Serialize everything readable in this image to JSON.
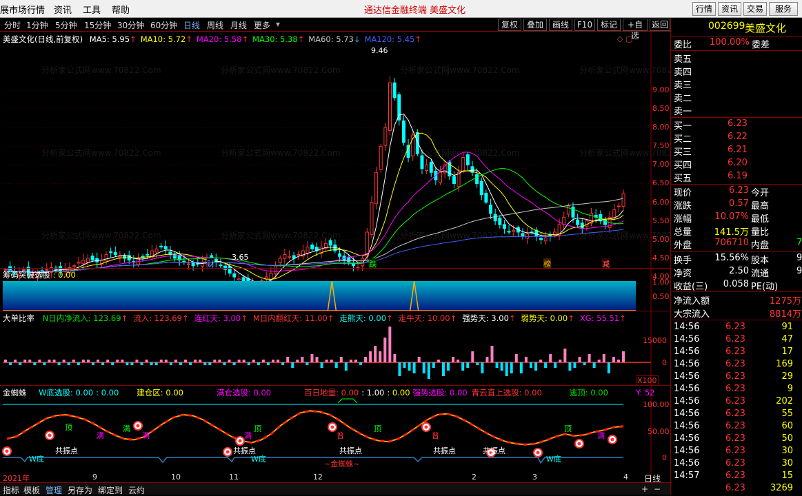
{
  "menubar": {
    "app_title": "展市场行情",
    "menus": [
      "资讯",
      "工具",
      "帮助"
    ],
    "center_title": "通达信金融终端   美盛文化",
    "right_buttons": [
      "行情",
      "资讯",
      "交易",
      "服务"
    ]
  },
  "periods": [
    "分时",
    "1分钟",
    "5分钟",
    "15分钟",
    "30分钟",
    "60分钟",
    "日线",
    "周线",
    "月线",
    "更多"
  ],
  "active_period": "日线",
  "toolbar": [
    "复权",
    "叠加",
    "画线",
    "F10",
    "标记",
    "+自选",
    "返回"
  ],
  "main": {
    "title": "美盛文化(日线,前复权)",
    "ma": [
      {
        "label": "MA5: 5.95",
        "color": "#ffffff"
      },
      {
        "label": "MA10: 5.72",
        "color": "#ffff00"
      },
      {
        "label": "MA20: 5.58",
        "color": "#ff00ff"
      },
      {
        "label": "MA30: 5.38",
        "color": "#00ff00"
      },
      {
        "label": "MA60: 5.73",
        "color": "#c8c8c8"
      },
      {
        "label": "MA120: 5.45",
        "color": "#4060ff"
      }
    ],
    "high_label": "9.46",
    "low_label": "3.65",
    "price_ticks": [
      "9.00",
      "8.50",
      "8.00",
      "7.50",
      "7.00",
      "6.50",
      "6.00",
      "5.50",
      "5.00",
      "4.50",
      "4.00"
    ],
    "event_marks": [
      "财",
      "跌",
      "榜",
      "减"
    ],
    "watermark": "分析家公式网www.70822.Com"
  },
  "chart_data": {
    "type": "candlestick",
    "price_axis": [
      3.65,
      9.46
    ],
    "close": [
      4.2,
      4.15,
      4.1,
      4.15,
      4.2,
      4.1,
      4.05,
      4.1,
      4.15,
      4.2,
      4.25,
      4.2,
      4.15,
      4.2,
      4.25,
      4.3,
      4.4,
      4.45,
      4.5,
      4.45,
      4.4,
      4.45,
      4.6,
      4.65,
      4.6,
      4.55,
      4.5,
      4.45,
      4.4,
      4.5,
      4.55,
      4.6,
      4.7,
      4.75,
      4.8,
      4.75,
      4.6,
      4.5,
      4.45,
      4.4,
      4.35,
      4.3,
      4.35,
      4.4,
      4.5,
      4.45,
      4.4,
      4.3,
      4.2,
      4.1,
      4.0,
      3.95,
      3.9,
      3.85,
      3.8,
      3.75,
      3.9,
      4.0,
      4.1,
      4.3,
      4.5,
      4.6,
      4.55,
      4.5,
      4.6,
      4.7,
      4.8,
      4.75,
      4.7,
      4.8,
      4.9,
      4.85,
      4.7,
      4.55,
      4.45,
      4.4,
      4.3,
      4.25,
      4.5,
      5.2,
      6.0,
      6.8,
      7.5,
      8.0,
      9.2,
      8.8,
      8.2,
      7.6,
      7.2,
      7.8,
      7.3,
      6.9,
      7.0,
      6.8,
      6.6,
      6.8,
      7.0,
      6.7,
      6.5,
      6.8,
      7.2,
      7.0,
      6.8,
      6.5,
      6.2,
      6.0,
      5.7,
      5.5,
      5.4,
      5.3,
      5.2,
      5.25,
      5.2,
      5.1,
      5.15,
      5.2,
      5.1,
      5.0,
      5.05,
      5.1,
      5.2,
      5.4,
      5.6,
      5.9,
      5.6,
      5.4,
      5.3,
      5.5,
      5.7,
      5.6,
      5.5,
      5.4,
      5.6,
      5.8,
      5.9,
      6.23
    ],
    "ma_names": [
      "MA5",
      "MA10",
      "MA20",
      "MA30",
      "MA60",
      "MA120"
    ],
    "indicator1": {
      "name": "筹码突破选股",
      "value": "0.00",
      "ticks": [
        "1.00",
        "0.50"
      ],
      "spikes_at": [
        0.52,
        0.65
      ]
    },
    "indicator2": {
      "name": "大单比率",
      "ticks": [
        "15000",
        "0"
      ],
      "x_label": "X100",
      "bars": [
        1,
        -1,
        1,
        -1,
        1,
        1,
        -1,
        1,
        -1,
        1,
        1,
        -1,
        1,
        -1,
        1,
        -1,
        1,
        1,
        -1,
        1,
        -1,
        1,
        -1,
        1,
        1,
        -1,
        -1,
        1,
        -1,
        1,
        -1,
        -1,
        1,
        1,
        -1,
        1,
        -1,
        1,
        -1,
        1,
        1,
        -1,
        -1,
        1,
        1,
        -1,
        1,
        -1,
        1,
        1,
        -1,
        1,
        -1,
        1,
        -1,
        1,
        1,
        -1,
        2,
        -2,
        1,
        2,
        -1,
        3,
        2,
        -2,
        1,
        1,
        -2,
        2,
        -3,
        1,
        1,
        -1,
        2,
        4,
        6,
        4,
        9,
        13,
        3,
        -5,
        -2,
        -3,
        -4,
        2,
        -4,
        -6,
        -2,
        1,
        -5,
        -3,
        2,
        1,
        -3,
        -2,
        4,
        -1,
        -4,
        2,
        6,
        -2,
        -3,
        -5,
        -4,
        3,
        -4,
        2,
        -2,
        -3,
        1,
        -2,
        3,
        -2,
        1,
        5,
        -3,
        -2,
        2,
        -1,
        3,
        -2,
        1,
        3,
        -4,
        2,
        1,
        4
      ]
    },
    "indicator3": {
      "name": "金蜘蛛",
      "ticks": [
        "100.00",
        "50.00",
        "0"
      ]
    }
  },
  "ind1": {
    "name": "筹码突破选股",
    "value": ": 0.00"
  },
  "ind2": {
    "name": "大单比率",
    "items": [
      {
        "label": "N日内净流入: 123.69",
        "color": "#00e000"
      },
      {
        "label": "流入: 123.69",
        "color": "#ff3232"
      },
      {
        "label": "连红天: 3.00",
        "color": "#ff00ff"
      },
      {
        "label": "M日内翻红天: 11.00",
        "color": "#ff3232"
      },
      {
        "label": "走熊天: 0.00",
        "color": "#00ffff"
      },
      {
        "label": "走牛天: 10.00",
        "color": "#ff3232"
      },
      {
        "label": "强势天: 3.00",
        "color": "#ffffff"
      },
      {
        "label": "弱势天: 0.00",
        "color": "#ffff00"
      },
      {
        "label": "XG: 55.51",
        "color": "#ff00ff"
      }
    ]
  },
  "ind3": {
    "name": "金蜘蛛",
    "items": [
      {
        "label": "W底选股: 0.00",
        "color": "#00ffff"
      },
      {
        "label": ": 0.00",
        "color": "#00ffff"
      },
      {
        "label": "建仓区: 0.00",
        "color": "#ffff00"
      },
      {
        "label": "满仓选股: 0.00",
        "color": "#ff00ff"
      },
      {
        "label": "百日地量: 0.00",
        "color": "#ff3232"
      },
      {
        "label": ": 1.00",
        "color": "#ffffff"
      },
      {
        "label": ": 0.00",
        "color": "#ffff00"
      },
      {
        "label": "强势选股: 0.00",
        "color": "#ff00ff"
      },
      {
        "label": "青云直上选股: 0.00",
        "color": "#ff3232"
      },
      {
        "label": "逃顶: 0.00",
        "color": "#00e000"
      },
      {
        "label": "Y: 52",
        "color": "#ff00ff"
      }
    ],
    "marks": [
      "顶",
      "满",
      "满",
      "满",
      "共振点",
      "W底",
      "满",
      "顶",
      "共振点",
      "W底",
      "普",
      "顶",
      "共振点",
      "普",
      "共振点",
      "共振点",
      "W底",
      "顶",
      "满",
      "~金蜘蛛~"
    ]
  },
  "date_axis": [
    "2021年",
    "9",
    "10",
    "11",
    "12",
    "2",
    "3",
    "4"
  ],
  "bottombar": [
    "指标",
    "模板",
    "管理",
    "另存为",
    "绑定到",
    "云约"
  ],
  "period_label": "日线",
  "quote": {
    "code": "002699",
    "name": "美盛文化",
    "weibi_label": "委比",
    "weibi": "100.00%",
    "weicha_label": "委差",
    "sell": [
      "卖五",
      "卖四",
      "卖三",
      "卖二",
      "卖一"
    ],
    "buy": [
      {
        "label": "买一",
        "price": "6.23",
        "vol": ""
      },
      {
        "label": "买二",
        "price": "6.22",
        "vol": ""
      },
      {
        "label": "买三",
        "price": "6.21",
        "vol": ""
      },
      {
        "label": "买四",
        "price": "6.20",
        "vol": ""
      },
      {
        "label": "买五",
        "price": "6.19",
        "vol": ""
      }
    ],
    "stats": [
      {
        "l": "现价",
        "v": "6.23",
        "vc": "#ff3232",
        "l2": "今开",
        "v2": ""
      },
      {
        "l": "涨跌",
        "v": "0.57",
        "vc": "#ff3232",
        "l2": "最高",
        "v2": ""
      },
      {
        "l": "涨幅",
        "v": "10.07%",
        "vc": "#ff3232",
        "l2": "最低",
        "v2": ""
      },
      {
        "l": "总量",
        "v": "141.5万",
        "vc": "#ffff00",
        "l2": "量比",
        "v2": ""
      },
      {
        "l": "外盘",
        "v": "706710",
        "vc": "#ff3232",
        "l2": "内盘",
        "v2": "7"
      }
    ],
    "stats2": [
      {
        "l": "换手",
        "v": "15.56%",
        "vc": "#ffffff",
        "l2": "股本",
        "v2": "9"
      },
      {
        "l": "净资",
        "v": "2.50",
        "vc": "#ffffff",
        "l2": "流通",
        "v2": "9"
      },
      {
        "l": "收益(三)",
        "v": "0.058",
        "vc": "#ffffff",
        "l2": "PE(动)",
        "v2": ""
      }
    ],
    "flow": [
      {
        "l": "净流入额",
        "v": "1275万"
      },
      {
        "l": "大宗流入",
        "v": "8814万"
      }
    ],
    "ticks": [
      {
        "t": "14:56",
        "p": "6.23",
        "v": "91"
      },
      {
        "t": "14:56",
        "p": "6.23",
        "v": "47"
      },
      {
        "t": "14:56",
        "p": "6.23",
        "v": "17"
      },
      {
        "t": "14:56",
        "p": "6.23",
        "v": "169"
      },
      {
        "t": "14:56",
        "p": "6.23",
        "v": "29"
      },
      {
        "t": "14:56",
        "p": "6.23",
        "v": "9"
      },
      {
        "t": "14:56",
        "p": "6.23",
        "v": "202"
      },
      {
        "t": "14:56",
        "p": "6.23",
        "v": "55"
      },
      {
        "t": "14:56",
        "p": "6.23",
        "v": "60"
      },
      {
        "t": "14:56",
        "p": "6.23",
        "v": "50"
      },
      {
        "t": "14:56",
        "p": "6.23",
        "v": "30"
      },
      {
        "t": "14:56",
        "p": "6.23",
        "v": "30"
      },
      {
        "t": "14:57",
        "p": "6.23",
        "v": "15"
      },
      {
        "t": "",
        "p": "6.23",
        "v": "3269"
      }
    ]
  }
}
